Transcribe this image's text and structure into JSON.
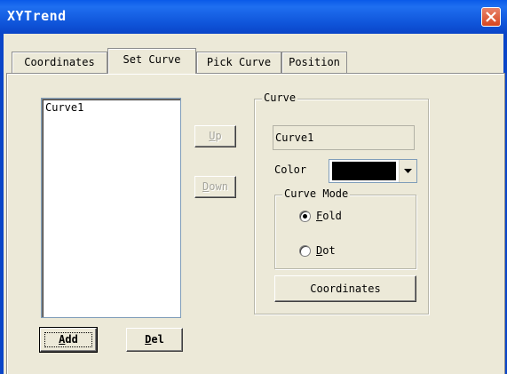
{
  "window": {
    "title": "XYTrend"
  },
  "tabs": [
    "Coordinates",
    "Set Curve",
    "Pick Curve",
    "Position"
  ],
  "list": {
    "items": [
      "Curve1"
    ]
  },
  "move_buttons": {
    "up_prefix": "",
    "up_key": "U",
    "up_rest": "p",
    "down_prefix": "",
    "down_key": "D",
    "down_rest": "own"
  },
  "list_buttons": {
    "add_key": "A",
    "add_rest": "dd",
    "del_key": "D",
    "del_rest": "el"
  },
  "curve": {
    "group_title": "Curve",
    "name_value": "Curve1",
    "color_label": "Color",
    "color_value": "#000000",
    "mode_group_title": "Curve Mode",
    "mode_fold_key": "F",
    "mode_fold_rest": "old",
    "mode_dot_key": "D",
    "mode_dot_rest": "ot",
    "selected_mode": "Fold",
    "coordinates_button": "Coordinates"
  }
}
